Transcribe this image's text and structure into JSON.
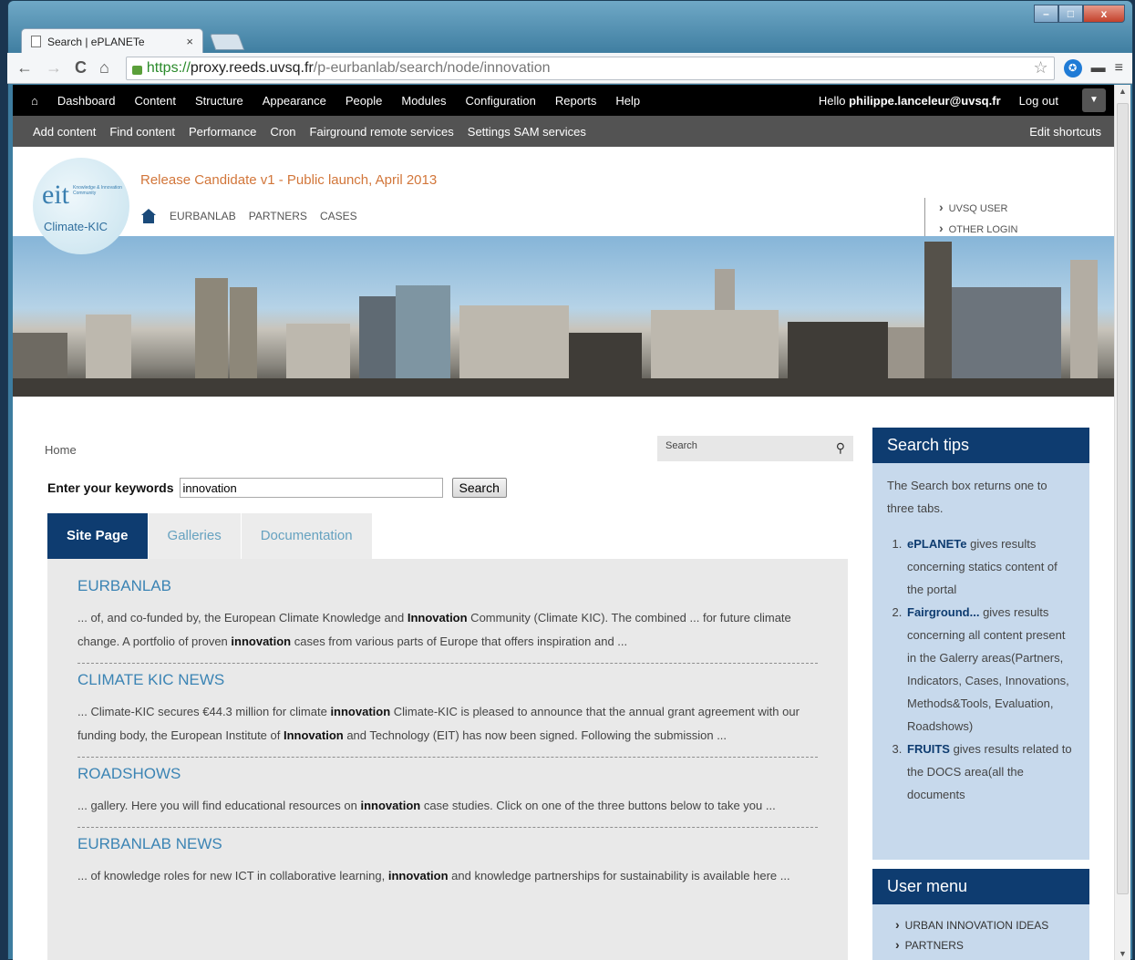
{
  "browser": {
    "tab_title": "Search | ePLANETe",
    "tab_close": "×",
    "url_scheme": "https://",
    "url_host": "proxy.reeds.uvsq.fr",
    "url_path": "/p-eurbanlab/search/node/innovation",
    "win_min": "–",
    "win_max": "□",
    "win_close": "x"
  },
  "admin_menu": {
    "items": [
      "Dashboard",
      "Content",
      "Structure",
      "Appearance",
      "People",
      "Modules",
      "Configuration",
      "Reports",
      "Help"
    ],
    "hello_prefix": "Hello ",
    "user": "philippe.lanceleur@uvsq.fr",
    "logout": "Log out"
  },
  "shortcuts": {
    "items": [
      "Add content",
      "Find content",
      "Performance",
      "Cron",
      "Fairground remote services",
      "Settings SAM services"
    ],
    "edit": "Edit shortcuts"
  },
  "header": {
    "logo_eit": "eit",
    "logo_tiny": "Knowledge & Innovation Community",
    "logo_sub": "Climate-KIC",
    "release": "Release Candidate v1 - Public launch, April 2013",
    "nav": [
      "EURBANLAB",
      "PARTNERS",
      "CASES"
    ],
    "login": [
      "UVSQ USER",
      "OTHER LOGIN"
    ]
  },
  "page": {
    "breadcrumb": "Home",
    "mini_search_placeholder": "Search",
    "keywords_label": "Enter your keywords",
    "keywords_value": "innovation",
    "search_button": "Search",
    "tabs": [
      "Site Page",
      "Galleries",
      "Documentation"
    ]
  },
  "results": [
    {
      "title": "EURBANLAB",
      "pre1": "... of, and co-funded by, the European Climate Knowledge and ",
      "b1": "Innovation",
      "post1": " Community (Climate KIC). The combined ... for future climate change. A portfolio of proven ",
      "b2": "innovation",
      "post2": " cases from various parts of Europe that offers inspiration and ..."
    },
    {
      "title": "CLIMATE KIC NEWS",
      "pre1": "... Climate-KIC secures €44.3 million for climate ",
      "b1": "innovation",
      "post1": " Climate-KIC is pleased to announce that the annual grant agreement with our funding body, the European Institute of ",
      "b2": "Innovation",
      "post2": " and Technology (EIT) has now been signed. Following the submission ..."
    },
    {
      "title": "ROADSHOWS",
      "pre1": "... gallery. Here you will find educational resources on ",
      "b1": "innovation",
      "post1": " case studies. Click on one of the three buttons below to take you ...",
      "b2": "",
      "post2": ""
    },
    {
      "title": "EURBANLAB NEWS",
      "pre1": "... of knowledge roles for new ICT in collaborative learning, ",
      "b1": "innovation",
      "post1": " and knowledge partnerships for sustainability is available here ...",
      "b2": "",
      "post2": ""
    }
  ],
  "search_tips": {
    "title": "Search tips",
    "intro": "The Search box returns one to three tabs.",
    "items": [
      {
        "bold": "ePLANETe",
        "text": " gives results concerning statics content of the portal"
      },
      {
        "bold": "Fairground...",
        "text": " gives results concerning all content present in the Galerry areas(Partners, Indicators, Cases, Innovations, Methods&Tools, Evaluation, Roadshows)"
      },
      {
        "bold": "FRUITS",
        "text": " gives results related to the DOCS area(all the documents"
      }
    ]
  },
  "user_menu": {
    "title": "User menu",
    "items": [
      "URBAN INNOVATION IDEAS",
      "PARTNERS"
    ]
  }
}
